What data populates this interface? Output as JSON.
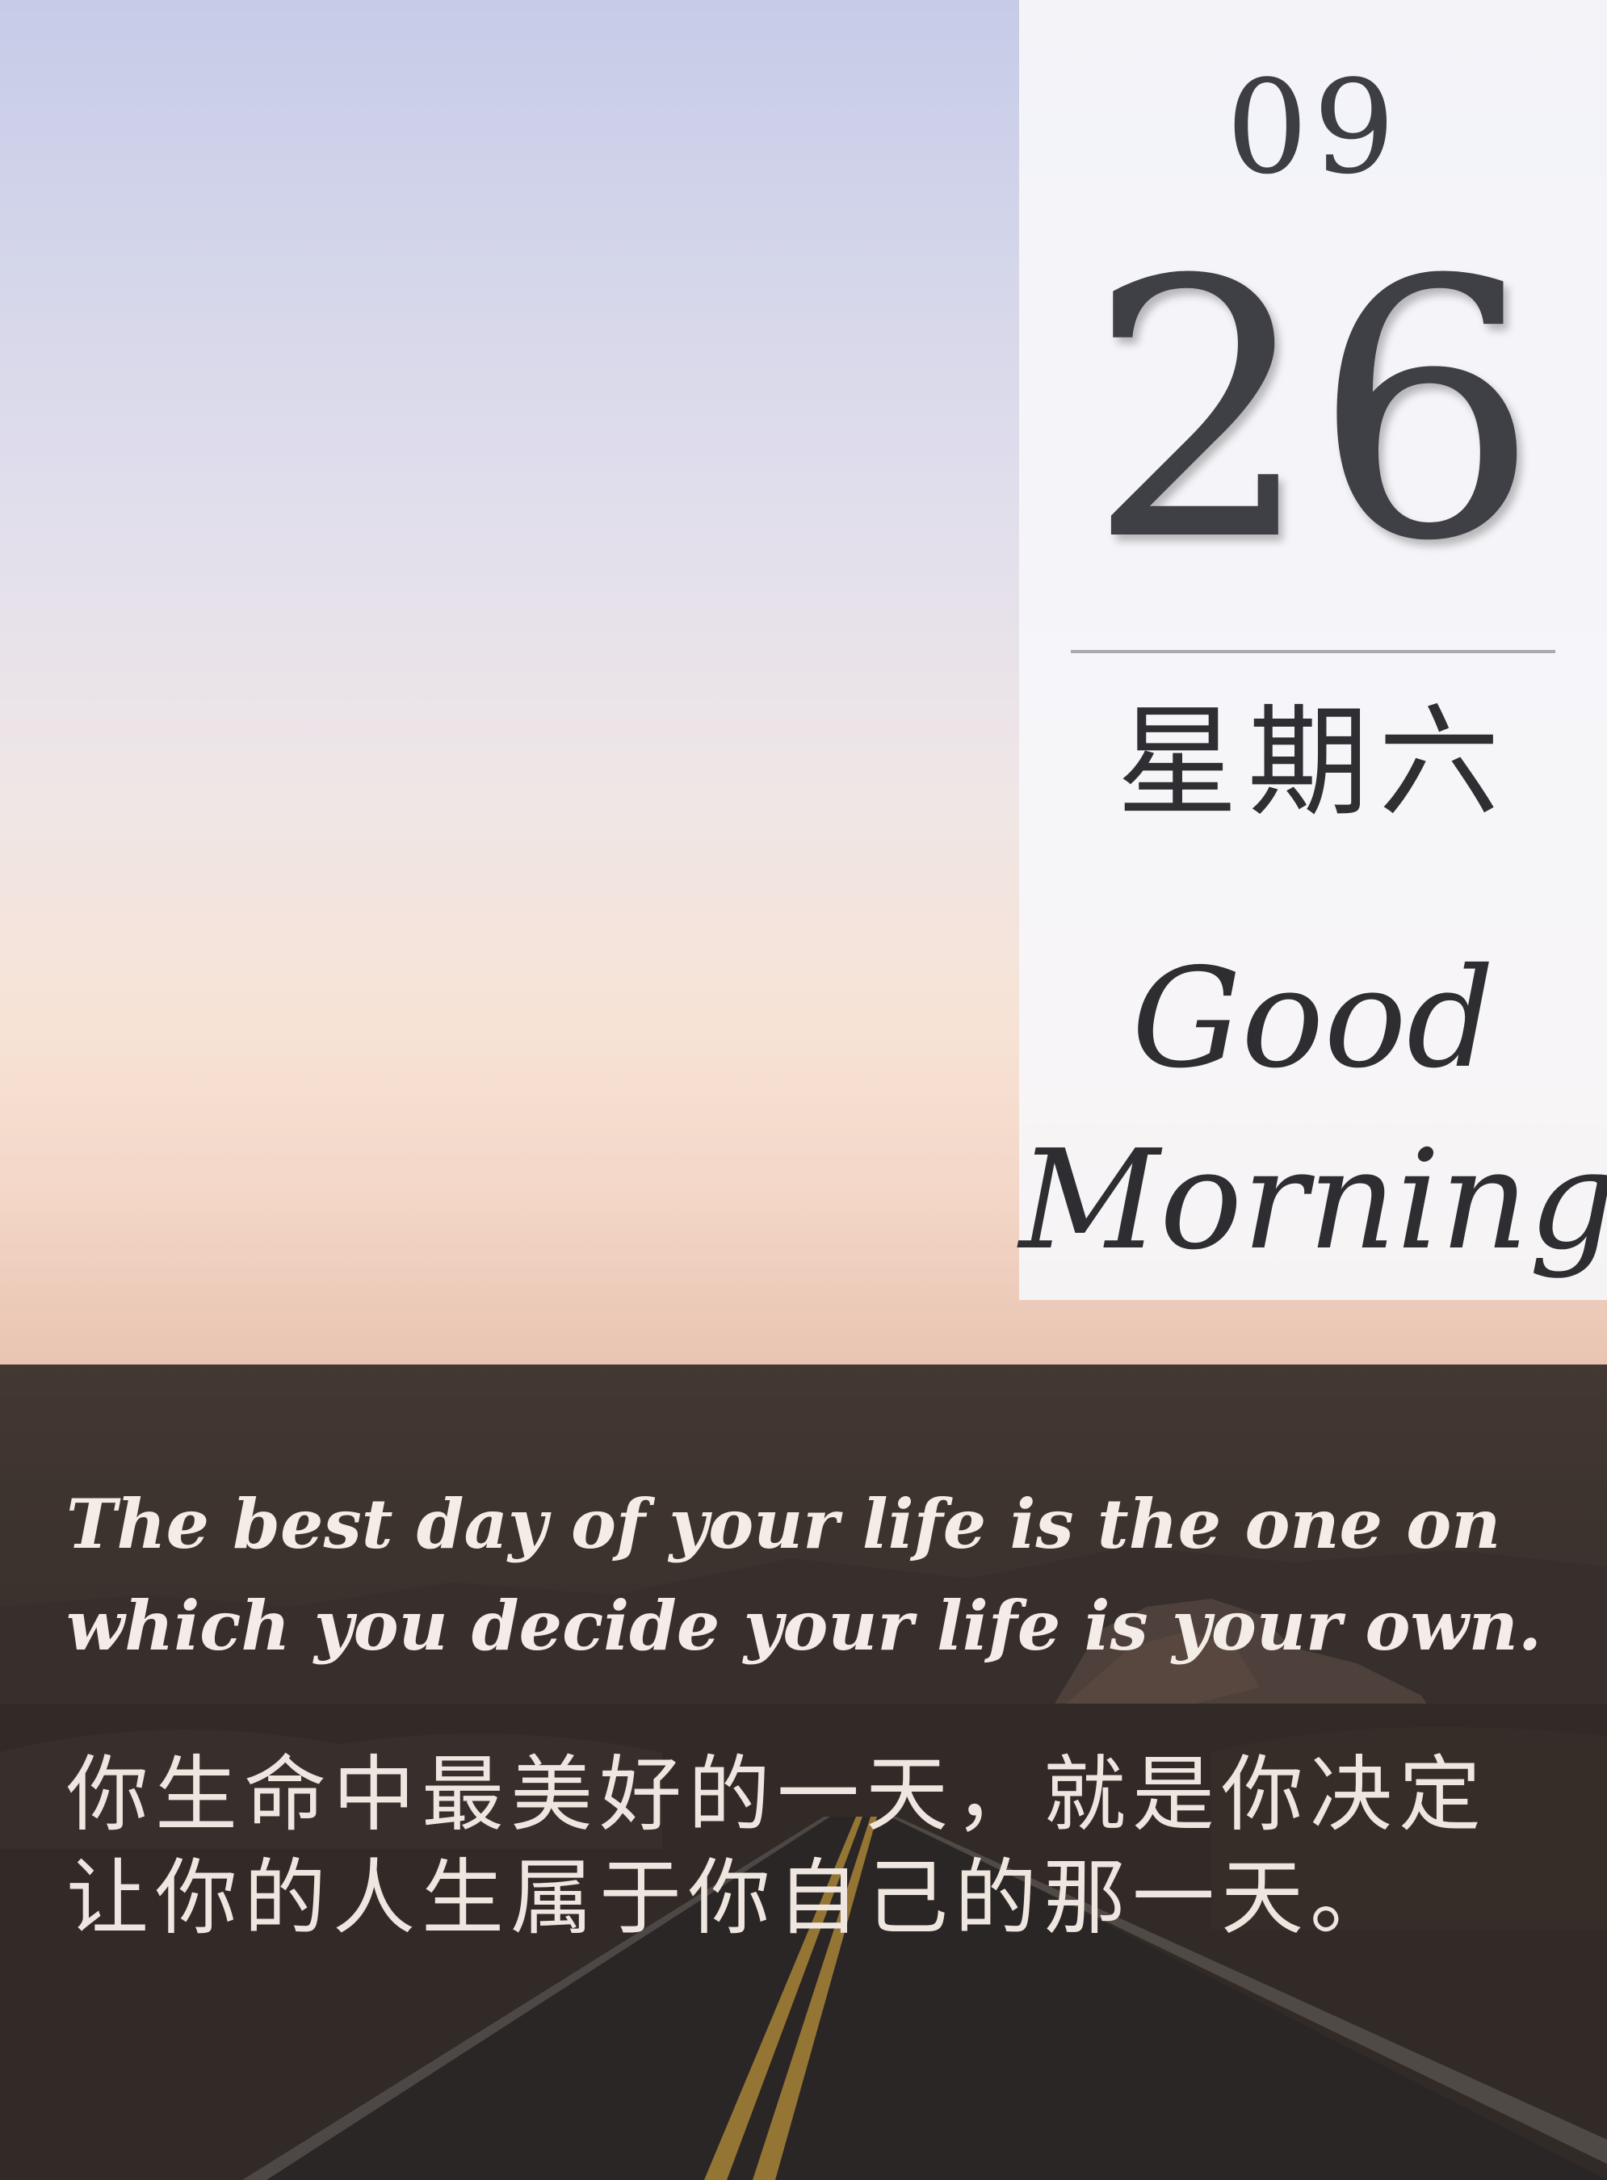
{
  "calendar": {
    "month": "09",
    "day": "26",
    "weekday": "星期六",
    "greeting_line1": "Good",
    "greeting_line2": "Morning"
  },
  "quote": {
    "english": "The best day of your life is the one on which you decide your life is your own.",
    "chinese": "你生命中最美好的一天，就是你决定让你的人生属于你自己的那一天。"
  },
  "colors": {
    "panel_bg": "#f6f6fa",
    "text_dark": "#3d3d44",
    "quote_text": "#f4ece6",
    "landscape": "#433933"
  }
}
